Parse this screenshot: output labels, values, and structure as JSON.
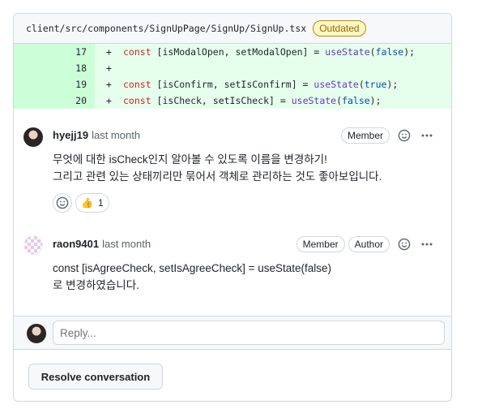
{
  "file": {
    "path": "client/src/components/SignUpPage/SignUp/SignUp.tsx",
    "status_badge": "Outdated"
  },
  "diff_lines": [
    {
      "number": "17",
      "sign": "+",
      "parts": [
        [
          "kw",
          "const"
        ],
        [
          "t",
          " [isModalOpen, setModalOpen] = "
        ],
        [
          "fn",
          "useState"
        ],
        [
          "t",
          "("
        ],
        [
          "lit",
          "false"
        ],
        [
          "t",
          ");"
        ]
      ]
    },
    {
      "number": "18",
      "sign": "+",
      "parts": []
    },
    {
      "number": "19",
      "sign": "+",
      "parts": [
        [
          "kw",
          "const"
        ],
        [
          "t",
          " [isConfirm, setIsConfirm] = "
        ],
        [
          "fn",
          "useState"
        ],
        [
          "t",
          "("
        ],
        [
          "lit",
          "true"
        ],
        [
          "t",
          ");"
        ]
      ]
    },
    {
      "number": "20",
      "sign": "+",
      "parts": [
        [
          "kw",
          "const"
        ],
        [
          "t",
          " [isCheck, setIsCheck] = "
        ],
        [
          "fn",
          "useState"
        ],
        [
          "t",
          "("
        ],
        [
          "lit",
          "false"
        ],
        [
          "t",
          ");"
        ]
      ]
    }
  ],
  "comments": [
    {
      "author": "hyejj19",
      "time": "last month",
      "badges": [
        "Member"
      ],
      "lines": [
        "무엇에 대한 isCheck인지 알아볼 수 있도록 이름을 변경하기!",
        "그리고 관련 있는 상태끼리만 묶어서 객체로 관리하는 것도 좋아보입니다."
      ],
      "reaction": {
        "emoji": "👍",
        "count": "1"
      }
    },
    {
      "author": "raon9401",
      "time": "last month",
      "badges": [
        "Member",
        "Author"
      ],
      "lines": [
        "const [isAgreeCheck, setIsAgreeCheck] = useState(false)",
        "로 변경하였습니다."
      ]
    }
  ],
  "reply": {
    "placeholder": "Reply..."
  },
  "resolve_label": "Resolve conversation",
  "icons": {
    "emoji_picker": "smiley-icon",
    "more": "kebab-horizontal-icon"
  }
}
